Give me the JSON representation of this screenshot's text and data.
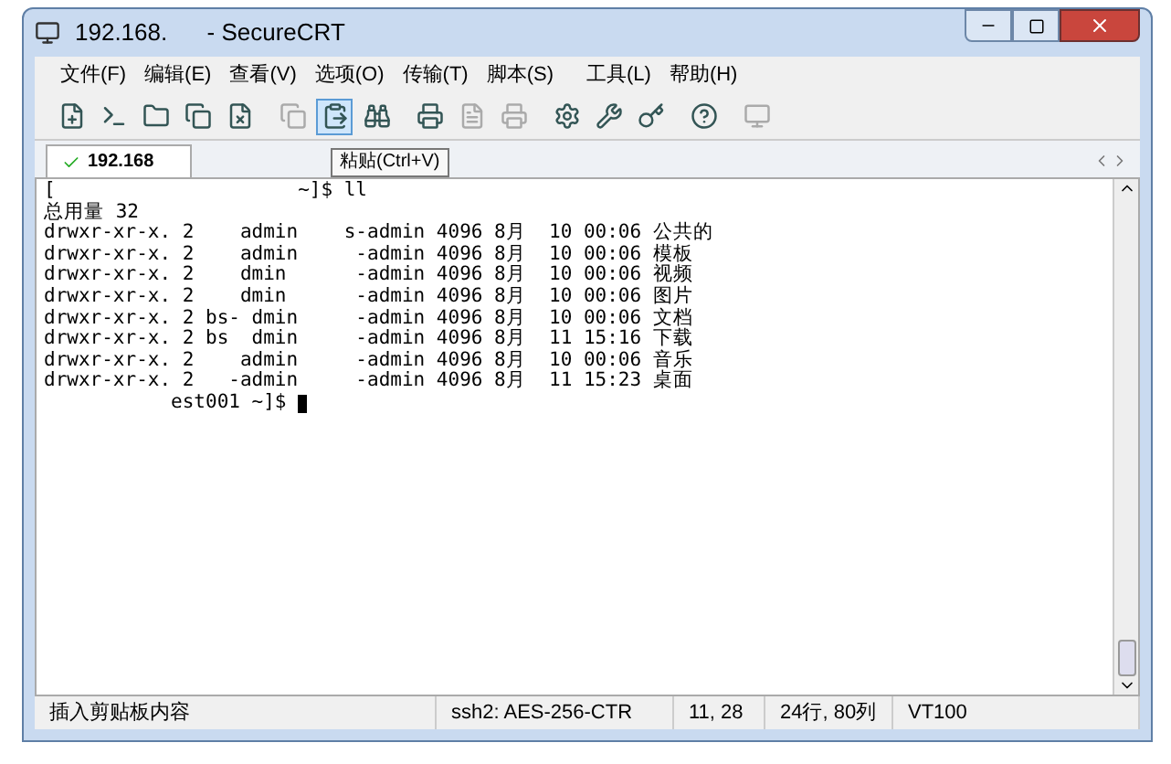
{
  "window": {
    "title": "192.168.      - SecureCRT"
  },
  "menu": [
    "文件(F)",
    "编辑(E)",
    "查看(V)",
    "选项(O)",
    "传输(T)",
    "脚本(S)",
    "工具(L)",
    "帮助(H)"
  ],
  "tabs": [
    {
      "label": "192.168",
      "selected": true
    }
  ],
  "tooltip": "粘贴(Ctrl+V)",
  "terminal": {
    "lines": [
      "[                     ~]$ ll",
      "总用量 32",
      "drwxr-xr-x. 2    admin    s-admin 4096 8月  10 00:06 公共的",
      "drwxr-xr-x. 2    admin     -admin 4096 8月  10 00:06 模板",
      "drwxr-xr-x. 2    dmin      -admin 4096 8月  10 00:06 视频",
      "drwxr-xr-x. 2    dmin      -admin 4096 8月  10 00:06 图片",
      "drwxr-xr-x. 2 bs- dmin     -admin 4096 8月  10 00:06 文档",
      "drwxr-xr-x. 2 bs  dmin     -admin 4096 8月  11 15:16 下载",
      "drwxr-xr-x. 2    admin     -admin 4096 8月  10 00:06 音乐",
      "drwxr-xr-x. 2   -admin     -admin 4096 8月  11 15:23 桌面",
      "           est001 ~]$ "
    ]
  },
  "status_bar": [
    "插入剪贴板内容",
    "ssh2: AES-256-CTR",
    "11, 28",
    "24行, 80列",
    "VT100"
  ]
}
